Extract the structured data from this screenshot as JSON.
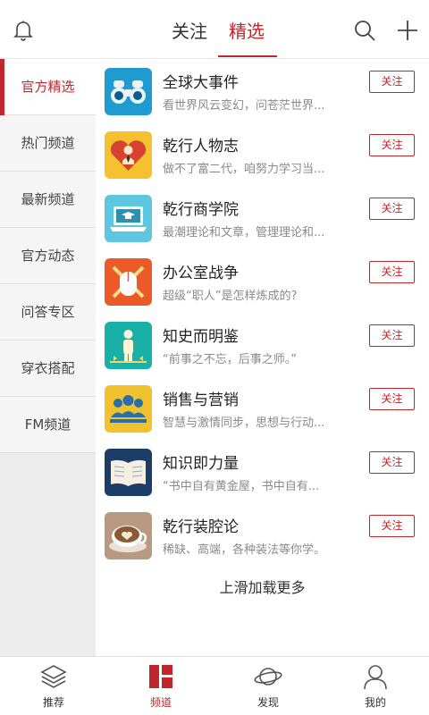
{
  "header": {
    "tabs": [
      {
        "label": "关注",
        "active": false
      },
      {
        "label": "精选",
        "active": true
      }
    ],
    "icons": [
      "bell-icon",
      "search-icon",
      "plus-icon"
    ]
  },
  "sidebar": {
    "items": [
      {
        "label": "官方精选",
        "active": true
      },
      {
        "label": "热门频道",
        "active": false
      },
      {
        "label": "最新频道",
        "active": false
      },
      {
        "label": "官方动态",
        "active": false
      },
      {
        "label": "问答专区",
        "active": false
      },
      {
        "label": "穿衣搭配",
        "active": false
      },
      {
        "label": "FM频道",
        "active": false
      }
    ]
  },
  "channels": [
    {
      "title": "全球大事件",
      "desc": "看世界风云变幻，问苍茫世界...",
      "follow": "关注",
      "icon": "binoculars-icon"
    },
    {
      "title": "乾行人物志",
      "desc": "做不了富二代，咱努力学习当...",
      "follow": "关注",
      "icon": "person-heart-icon"
    },
    {
      "title": "乾行商学院",
      "desc": "最潮理论和文章，管理理论和...",
      "follow": "关注",
      "icon": "laptop-graduation-icon"
    },
    {
      "title": "办公室战争",
      "desc": "超级“职人”是怎样炼成的?",
      "follow": "关注",
      "icon": "mouse-swords-icon"
    },
    {
      "title": "知史而明鉴",
      "desc": "“前事之不忘，后事之师。”",
      "follow": "关注",
      "icon": "history-figure-icon"
    },
    {
      "title": "销售与营销",
      "desc": "智慧与激情同步，思想与行动...",
      "follow": "关注",
      "icon": "team-icon"
    },
    {
      "title": "知识即力量",
      "desc": "“书中自有黄金屋，书中自有...",
      "follow": "关注",
      "icon": "open-book-icon"
    },
    {
      "title": "乾行装腔论",
      "desc": "稀缺、高端，各种装法等你学。",
      "follow": "关注",
      "icon": "coffee-cup-icon"
    }
  ],
  "load_more": "上滑加载更多",
  "bottom_nav": [
    {
      "label": "推荐",
      "icon": "layers-icon",
      "active": false
    },
    {
      "label": "频道",
      "icon": "grid-blocks-icon",
      "active": true
    },
    {
      "label": "发现",
      "icon": "planet-icon",
      "active": false
    },
    {
      "label": "我的",
      "icon": "user-icon",
      "active": false
    }
  ],
  "colors": {
    "accent": "#c0272d",
    "sidebar_bg": "#ececec",
    "text": "#333333",
    "muted": "#8a8a8a"
  }
}
